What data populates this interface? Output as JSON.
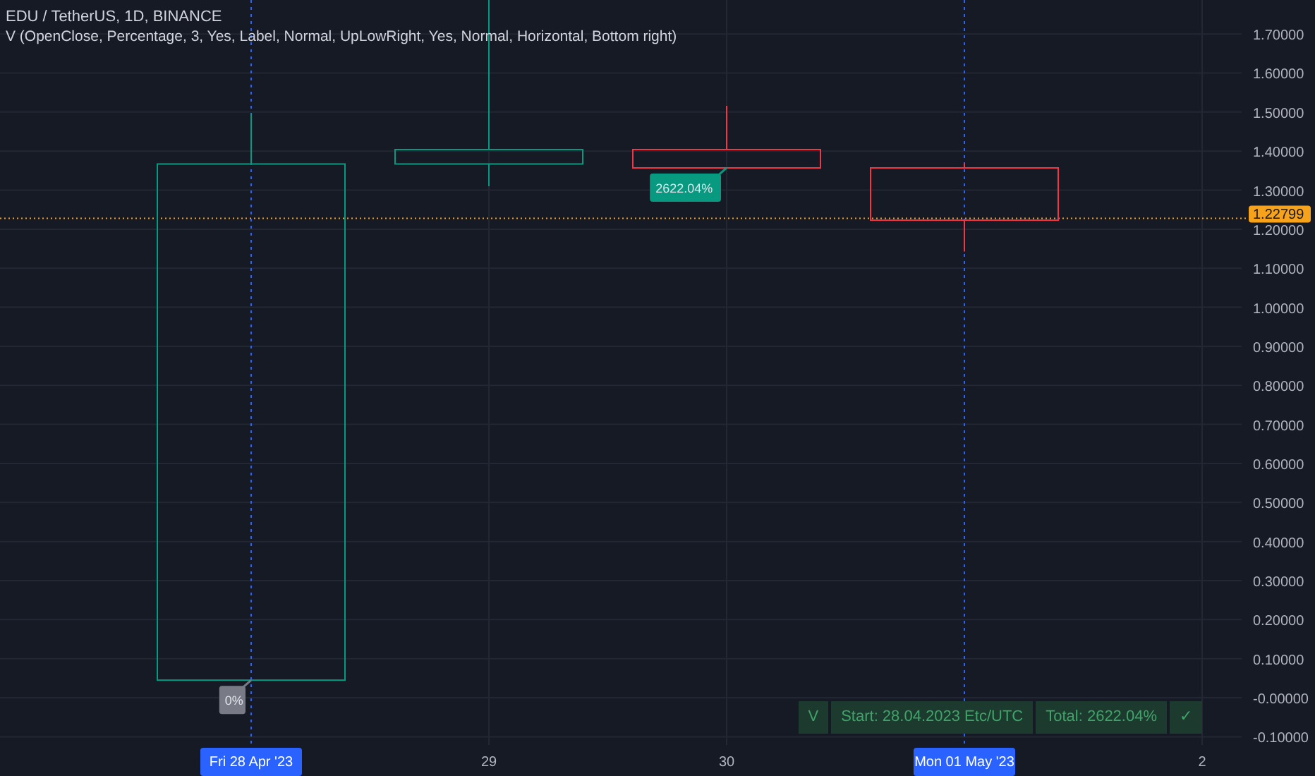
{
  "legend": {
    "symbol": "EDU / TetherUS, 1D, BINANCE",
    "indicator": "V (OpenClose, Percentage, 3, Yes, Label, Normal, UpLowRight, Yes, Normal, Horizontal, Bottom right)"
  },
  "price_axis": [
    "1.70000",
    "1.60000",
    "1.50000",
    "1.40000",
    "1.30000",
    "1.20000",
    "1.10000",
    "1.00000",
    "0.90000",
    "0.80000",
    "0.70000",
    "0.60000",
    "0.50000",
    "0.40000",
    "0.30000",
    "0.20000",
    "0.10000",
    "-0.00000",
    "-0.10000"
  ],
  "last_price": "1.22799",
  "candle_labels": [
    {
      "text": "0%",
      "color": "#787b86"
    },
    {
      "text": "2622.04%",
      "color": "#089981"
    }
  ],
  "time_axis": [
    {
      "label": "Fri 28 Apr '23",
      "selected": true
    },
    {
      "label": "29",
      "selected": false
    },
    {
      "label": "30",
      "selected": false
    },
    {
      "label": "Mon 01 May '23",
      "selected": true
    },
    {
      "label": "2",
      "selected": false
    }
  ],
  "status": {
    "items": [
      "V",
      "Start: 28.04.2023 Etc/UTC",
      "Total: 2622.04%",
      "✓"
    ]
  }
}
